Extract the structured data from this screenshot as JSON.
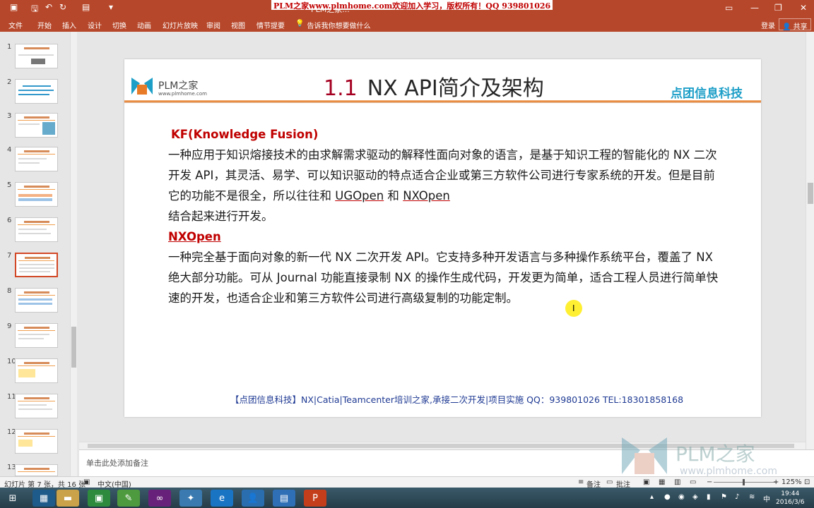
{
  "titlebar": {
    "title": "PLM之家...",
    "watermark": "PLM之家www.plmhome.com欢迎加入学习，版权所有！QQ 939801026",
    "quick_access": [
      "save-icon",
      "undo-icon",
      "redo-icon",
      "present-icon",
      "customize-icon"
    ]
  },
  "ribbon": {
    "tabs": [
      "文件",
      "开始",
      "插入",
      "设计",
      "切换",
      "动画",
      "幻灯片放映",
      "审阅",
      "视图",
      "情节提要"
    ],
    "tell_me": "告诉我你想要做什么",
    "login": "登录",
    "share": "共享"
  },
  "thumbnails": {
    "numbers": [
      "1",
      "2",
      "3",
      "4",
      "5",
      "6",
      "7",
      "8",
      "9",
      "10",
      "11",
      "12",
      "13"
    ],
    "selected": "7"
  },
  "slide": {
    "logo_text": "PLM之家",
    "logo_url": "www.plmhome.com",
    "title_num": "1.1",
    "title_text": "NX API简介及架构",
    "company": "点团信息科技",
    "kf_heading": "KF(Knowledge Fusion)",
    "kf_text_1": "一种应用于知识熔接技术的由求解需求驱动的解释性面向对象的语言，是基于知识工程的智能化的 NX 二次开发 API，其灵活、易学、可以知识驱动的特点适合企业或第三方软件公司进行专家系统的开发。但是目前它的功能不是很全，所以往往和 ",
    "kf_link_1": "UGOpen",
    "kf_and": " 和 ",
    "kf_link_2": "NXOpen",
    "kf_text_2": "结合起来进行开发。",
    "nx_heading": "NXOpen",
    "nx_text": "一种完全基于面向对象的新一代 NX 二次开发 API。它支持多种开发语言与多种操作系统平台，覆盖了 NX 绝大部分功能。可从 Journal  功能直接录制 NX 的操作生成代码，开发更为简单，适合工程人员进行简单快速的开发，也适合企业和第三方软件公司进行高级复制的功能定制。",
    "footer": "【点团信息科技】NX|Catia|Teamcenter培训之家,承接二次开发|项目实施 QQ：939801026 TEL:18301858168"
  },
  "notes": {
    "placeholder": "单击此处添加备注"
  },
  "watermark_logo": {
    "big": "PLM之家",
    "small": "www.plmhome.com"
  },
  "status": {
    "slide_info": "幻灯片 第 7 张，共 16 张",
    "language": "中文(中国)",
    "notes": "备注",
    "comments": "批注",
    "zoom": "125%"
  },
  "taskbar": {
    "time": "19:44",
    "date": "2016/3/6",
    "ime": "中"
  }
}
